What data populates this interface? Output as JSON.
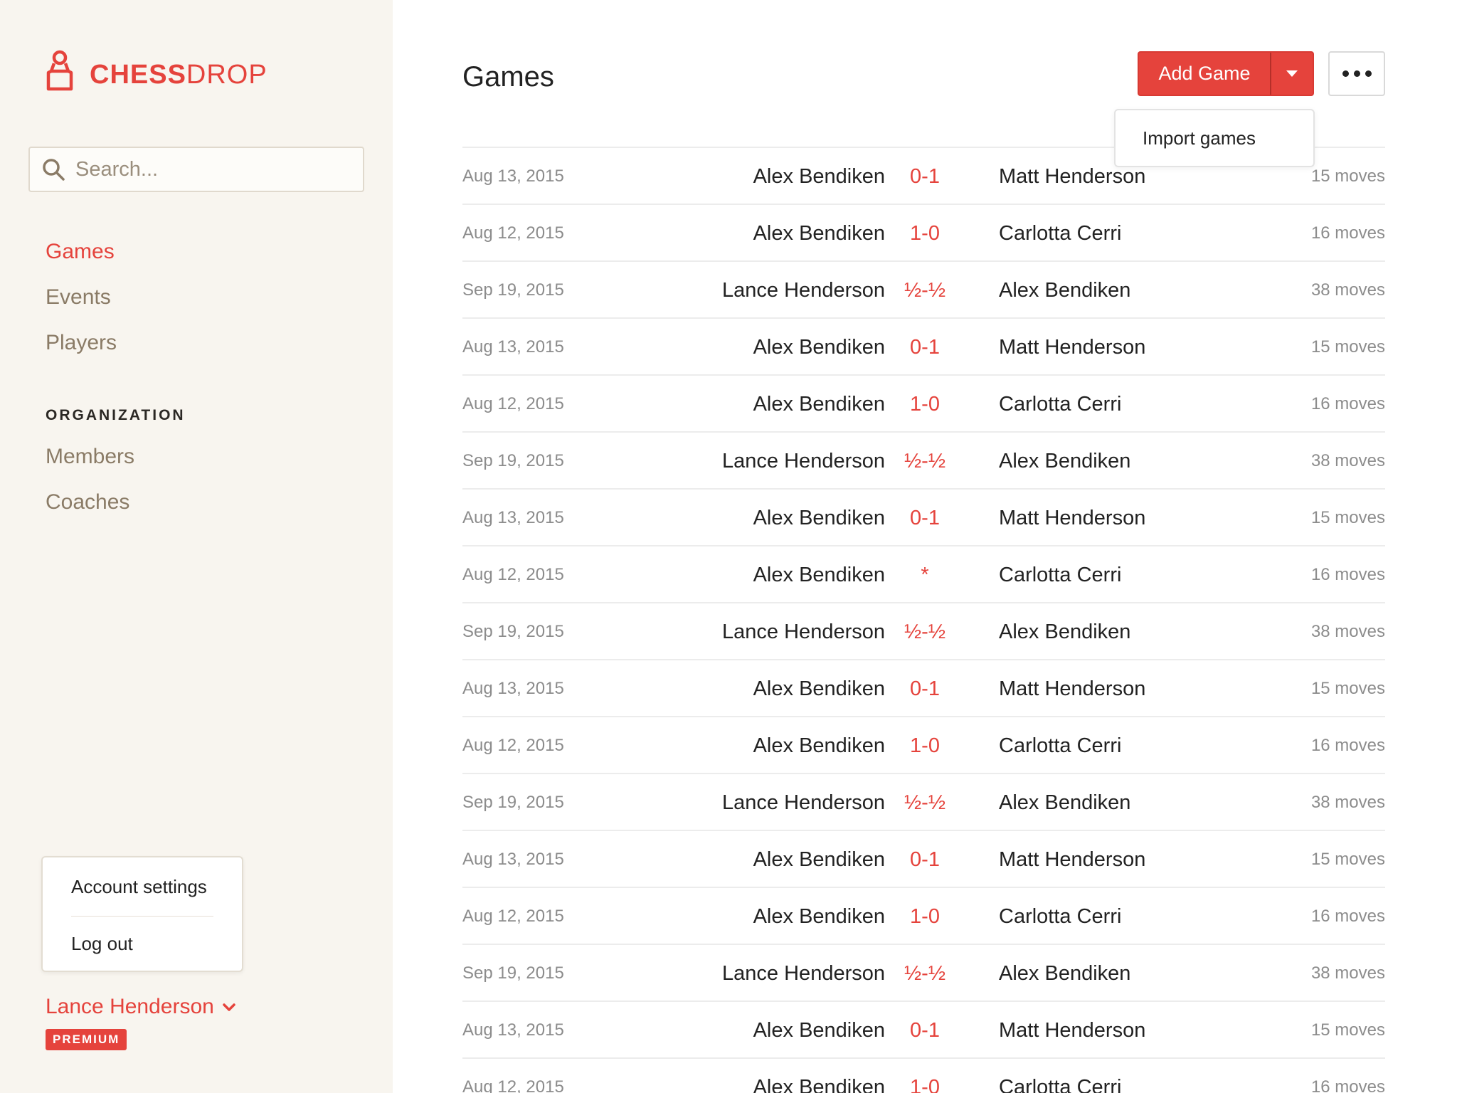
{
  "app": {
    "logo_bold": "CHESS",
    "logo_light": "DROP",
    "brand_color": "#e5433c"
  },
  "search": {
    "placeholder": "Search..."
  },
  "nav": {
    "items": [
      {
        "label": "Games"
      },
      {
        "label": "Events"
      },
      {
        "label": "Players"
      }
    ],
    "section_heading": "ORGANIZATION",
    "org_items": [
      {
        "label": "Members"
      },
      {
        "label": "Coaches"
      }
    ]
  },
  "account_menu": {
    "settings": "Account settings",
    "logout": "Log out"
  },
  "user": {
    "name": "Lance Henderson",
    "badge": "PREMIUM"
  },
  "header": {
    "title": "Games",
    "add_game": "Add Game",
    "import_games": "Import games"
  },
  "games": [
    {
      "date": "Aug 13, 2015",
      "white": "Alex Bendiken",
      "result": "0-1",
      "black": "Matt Henderson",
      "moves": "15 moves"
    },
    {
      "date": "Aug 12, 2015",
      "white": "Alex Bendiken",
      "result": "1-0",
      "black": "Carlotta Cerri",
      "moves": "16 moves"
    },
    {
      "date": "Sep 19, 2015",
      "white": "Lance Henderson",
      "result": "½-½",
      "black": "Alex Bendiken",
      "moves": "38 moves"
    },
    {
      "date": "Aug 13, 2015",
      "white": "Alex Bendiken",
      "result": "0-1",
      "black": "Matt Henderson",
      "moves": "15 moves"
    },
    {
      "date": "Aug 12, 2015",
      "white": "Alex Bendiken",
      "result": "1-0",
      "black": "Carlotta Cerri",
      "moves": "16 moves"
    },
    {
      "date": "Sep 19, 2015",
      "white": "Lance Henderson",
      "result": "½-½",
      "black": "Alex Bendiken",
      "moves": "38 moves"
    },
    {
      "date": "Aug 13, 2015",
      "white": "Alex Bendiken",
      "result": "0-1",
      "black": "Matt Henderson",
      "moves": "15 moves"
    },
    {
      "date": "Aug 12, 2015",
      "white": "Alex Bendiken",
      "result": "*",
      "black": "Carlotta Cerri",
      "moves": "16 moves"
    },
    {
      "date": "Sep 19, 2015",
      "white": "Lance Henderson",
      "result": "½-½",
      "black": "Alex Bendiken",
      "moves": "38 moves"
    },
    {
      "date": "Aug 13, 2015",
      "white": "Alex Bendiken",
      "result": "0-1",
      "black": "Matt Henderson",
      "moves": "15 moves"
    },
    {
      "date": "Aug 12, 2015",
      "white": "Alex Bendiken",
      "result": "1-0",
      "black": "Carlotta Cerri",
      "moves": "16 moves"
    },
    {
      "date": "Sep 19, 2015",
      "white": "Lance Henderson",
      "result": "½-½",
      "black": "Alex Bendiken",
      "moves": "38 moves"
    },
    {
      "date": "Aug 13, 2015",
      "white": "Alex Bendiken",
      "result": "0-1",
      "black": "Matt Henderson",
      "moves": "15 moves"
    },
    {
      "date": "Aug 12, 2015",
      "white": "Alex Bendiken",
      "result": "1-0",
      "black": "Carlotta Cerri",
      "moves": "16 moves"
    },
    {
      "date": "Sep 19, 2015",
      "white": "Lance Henderson",
      "result": "½-½",
      "black": "Alex Bendiken",
      "moves": "38 moves"
    },
    {
      "date": "Aug 13, 2015",
      "white": "Alex Bendiken",
      "result": "0-1",
      "black": "Matt Henderson",
      "moves": "15 moves"
    },
    {
      "date": "Aug 12, 2015",
      "white": "Alex Bendiken",
      "result": "1-0",
      "black": "Carlotta Cerri",
      "moves": "16 moves"
    }
  ],
  "icons": {
    "logo": "chess-pawn-icon",
    "search": "search-icon",
    "user_menu": "chevron-down-icon",
    "add_game_menu": "caret-down-icon",
    "more": "more-horizontal-icon"
  }
}
